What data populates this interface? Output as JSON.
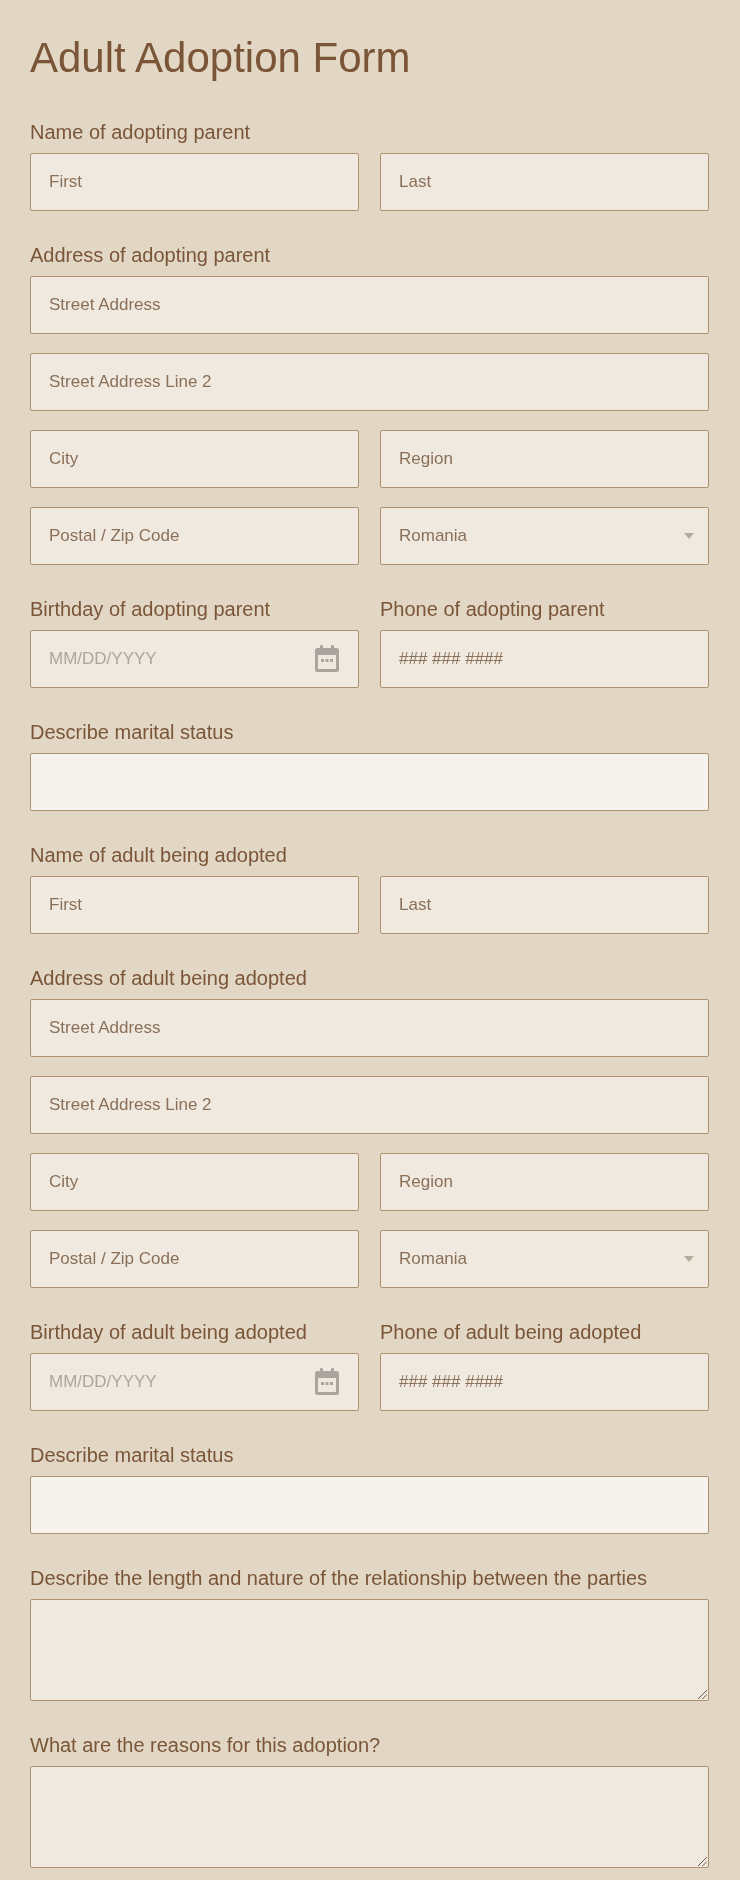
{
  "title": "Adult Adoption Form",
  "sections": [
    {
      "kind": "group",
      "label": "Name of adopting parent",
      "rows": [
        [
          {
            "kind": "text",
            "placeholder": "First"
          },
          {
            "kind": "text",
            "placeholder": "Last"
          }
        ]
      ]
    },
    {
      "kind": "group",
      "label": "Address of adopting parent",
      "rows": [
        [
          {
            "kind": "text",
            "placeholder": "Street Address"
          }
        ],
        [
          {
            "kind": "text",
            "placeholder": "Street Address Line 2"
          }
        ],
        [
          {
            "kind": "text",
            "placeholder": "City"
          },
          {
            "kind": "text",
            "placeholder": "Region"
          }
        ],
        [
          {
            "kind": "text",
            "placeholder": "Postal / Zip Code"
          },
          {
            "kind": "select",
            "value": "Romania"
          }
        ]
      ]
    },
    {
      "kind": "pair",
      "items": [
        {
          "label": "Birthday of adopting parent",
          "field": {
            "kind": "date",
            "placeholder": "MM/DD/YYYY"
          }
        },
        {
          "label": "Phone of adopting parent",
          "field": {
            "kind": "text",
            "placeholder": "### ### ####"
          }
        }
      ]
    },
    {
      "kind": "group",
      "label": "Describe marital status",
      "rows": [
        [
          {
            "kind": "plain"
          }
        ]
      ]
    },
    {
      "kind": "group",
      "label": "Name of adult being adopted",
      "rows": [
        [
          {
            "kind": "text",
            "placeholder": "First"
          },
          {
            "kind": "text",
            "placeholder": "Last"
          }
        ]
      ]
    },
    {
      "kind": "group",
      "label": "Address of adult being adopted",
      "rows": [
        [
          {
            "kind": "text",
            "placeholder": "Street Address"
          }
        ],
        [
          {
            "kind": "text",
            "placeholder": "Street Address Line 2"
          }
        ],
        [
          {
            "kind": "text",
            "placeholder": "City"
          },
          {
            "kind": "text",
            "placeholder": "Region"
          }
        ],
        [
          {
            "kind": "text",
            "placeholder": "Postal / Zip Code"
          },
          {
            "kind": "select",
            "value": "Romania"
          }
        ]
      ]
    },
    {
      "kind": "pair",
      "items": [
        {
          "label": "Birthday of adult being adopted",
          "field": {
            "kind": "date",
            "placeholder": "MM/DD/YYYY"
          }
        },
        {
          "label": "Phone of adult being adopted",
          "field": {
            "kind": "text",
            "placeholder": "### ### ####"
          }
        }
      ]
    },
    {
      "kind": "group",
      "label": "Describe marital status",
      "rows": [
        [
          {
            "kind": "plain"
          }
        ]
      ]
    },
    {
      "kind": "group",
      "label": "Describe the length and nature of the relationship between the parties",
      "rows": [
        [
          {
            "kind": "textarea"
          }
        ]
      ]
    },
    {
      "kind": "group",
      "label": "What are the reasons for this adoption?",
      "rows": [
        [
          {
            "kind": "textarea"
          }
        ]
      ]
    }
  ]
}
